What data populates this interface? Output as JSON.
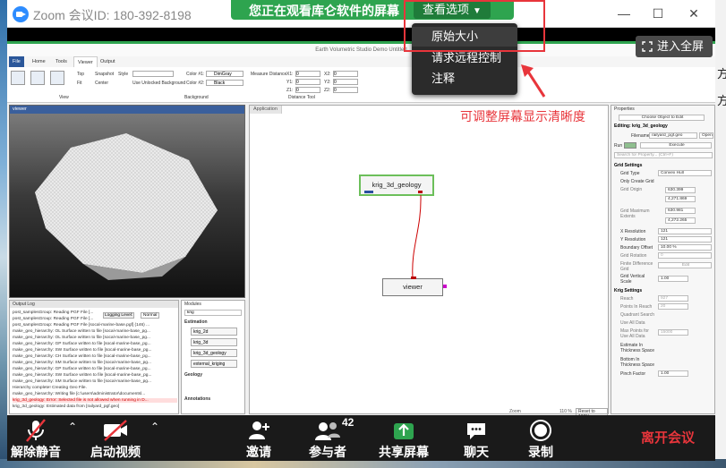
{
  "window": {
    "title": "Zoom 会议ID: 180-392-8198",
    "minimize": "—",
    "maximize": "☐",
    "close": "✕"
  },
  "share": {
    "banner_text": "您正在观看库仑软件的屏幕",
    "view_options_label": "查看选项",
    "menu_items": [
      "原始大小",
      "请求远程控制",
      "注释"
    ],
    "fullscreen_label": "进入全屏"
  },
  "callout": {
    "text": "可调整屏幕显示清晰度",
    "color": "#e8353b"
  },
  "desktop": {
    "right_glyphs": [
      "方",
      "方"
    ]
  },
  "shared_app": {
    "title": "Earth Volumetric Studio Demo Untitled",
    "tabs": [
      "File",
      "Home",
      "Tools",
      "Viewer",
      "Output"
    ],
    "ribbon": {
      "group_view": "View",
      "group_background": "Background",
      "group_distance": "Distance Tool",
      "items": [
        "Top",
        "Fit",
        "Snapshot",
        "Center",
        "Style",
        "Use Unlocked Background",
        "Color #1:",
        "Color #2:",
        "DimGray",
        "Black",
        "Measure Distance",
        "X1:",
        "Y1:",
        "Z1:",
        "X2:",
        "Y2:",
        "Z2:",
        "0"
      ]
    },
    "viewer_panel_title": "viewer",
    "application_tab": "Application",
    "nodes": [
      "krig_3d_geology",
      "viewer"
    ],
    "output_log": {
      "title": "Output Log",
      "filter_label": "Logging Level:",
      "filter_value": "Normal",
      "lines": [
        "post_samplesGroup: Reading PGF File [...",
        "post_samplesGroup: Reading PGF File [...",
        "post_samplesGroup: Reading PGF File [socal-marine-base.pgf] (146) ...",
        "make_geo_hierarchy: OL Surface written to file [socal-marine-base_pg...",
        "make_geo_hierarchy: OL Surface written to file [socal-marine-base_pg...",
        "make_geo_hierarchy: GP Surface written to file [socal-marine-base_pg...",
        "make_geo_hierarchy: SW Surface written to file [socal-marine-base_pg...",
        "make_geo_hierarchy: CH Surface written to file [socal-marine-base_pg...",
        "make_geo_hierarchy: SM Surface written to file [socal-marine-base_pg...",
        "make_geo_hierarchy: GP Surface written to file [socal-marine-base_pg...",
        "make_geo_hierarchy: SW Surface written to file [socal-marine-base_pg...",
        "make_geo_hierarchy: SM Surface written to file [socal-marine-base_pg...",
        "Hierarchy complete! Creating Geo File.",
        "make_geo_hierarchy: Writing file [c:\\users\\administrator\\documentsl...",
        "krig_3d_geology: Error: Selected file is not allowed when running in D...",
        "krig_3d_geology: Estimated data from [railyard_pgf.geo]"
      ]
    },
    "modules": {
      "title": "Modules",
      "search": "krig",
      "estimation_head": "Estimation",
      "items": [
        "krig_2d",
        "krig_3d",
        "krig_3d_geology",
        "external_kriging"
      ],
      "geology_head": "Geology",
      "annotations_head": "Annotations"
    },
    "properties": {
      "title": "Properties",
      "choose_object": "Choose Object to Edit",
      "editing": "Editing: krig_3d_geology",
      "filename_label": "Filename",
      "filename_value": "railyard_pgf.geo",
      "open": "Open",
      "run": "Run",
      "execute": "Execute",
      "search_placeholder": "Search for Property... (Ctrl+F)",
      "grid_settings": "Grid Settings",
      "grid_type_label": "Grid Type",
      "grid_type_value": "Convex Hull",
      "only_convex_grid": "Only Create Grid",
      "grid_origin": "Grid Origin",
      "origin_x": "630.399",
      "origin_y": "4,271.869",
      "grid_max": "Grid Maximum Extents",
      "max_x": "630.981",
      "max_y": "4,272.265",
      "x_res_label": "X Resolution",
      "x_res_value": "121",
      "y_res_label": "Y Resolution",
      "y_res_value": "121",
      "boundary_label": "Boundary Offset",
      "boundary_value": "10.00 %",
      "grid_rotation": "Grid Rotation",
      "grid_rotation_value": "0",
      "finite_diff": "Finite Difference Grid",
      "edit": "Edit",
      "vertical_scale": "Grid Vertical Scale",
      "vertical_scale_value": "1.00",
      "krig_settings": "Krig Settings",
      "reach": "Reach",
      "reach_value": "927",
      "points_in_reach": "Points In Reach",
      "points_value": "20",
      "quadrant": "Quadrant Search",
      "use_all_data": "Use All Data",
      "max_points": "Max Points for Use All Data",
      "max_points_value": "15000",
      "estimate_thickness": "Estimate In Thickness Space",
      "bottom_in_thickness": "Bottom In Thickness Space",
      "pinch_factor": "Pinch Factor",
      "pinch_value": "1.00"
    },
    "status": {
      "zoom": "Zoom",
      "zoom_value": "110 %",
      "reset": "Reset to 100%"
    }
  },
  "toolbar": {
    "unmute": "解除静音",
    "start_video": "启动视频",
    "invite": "邀请",
    "participants": "参与者",
    "participant_count": "42",
    "share_screen": "共享屏幕",
    "chat": "聊天",
    "record": "录制",
    "leave": "离开会议"
  }
}
